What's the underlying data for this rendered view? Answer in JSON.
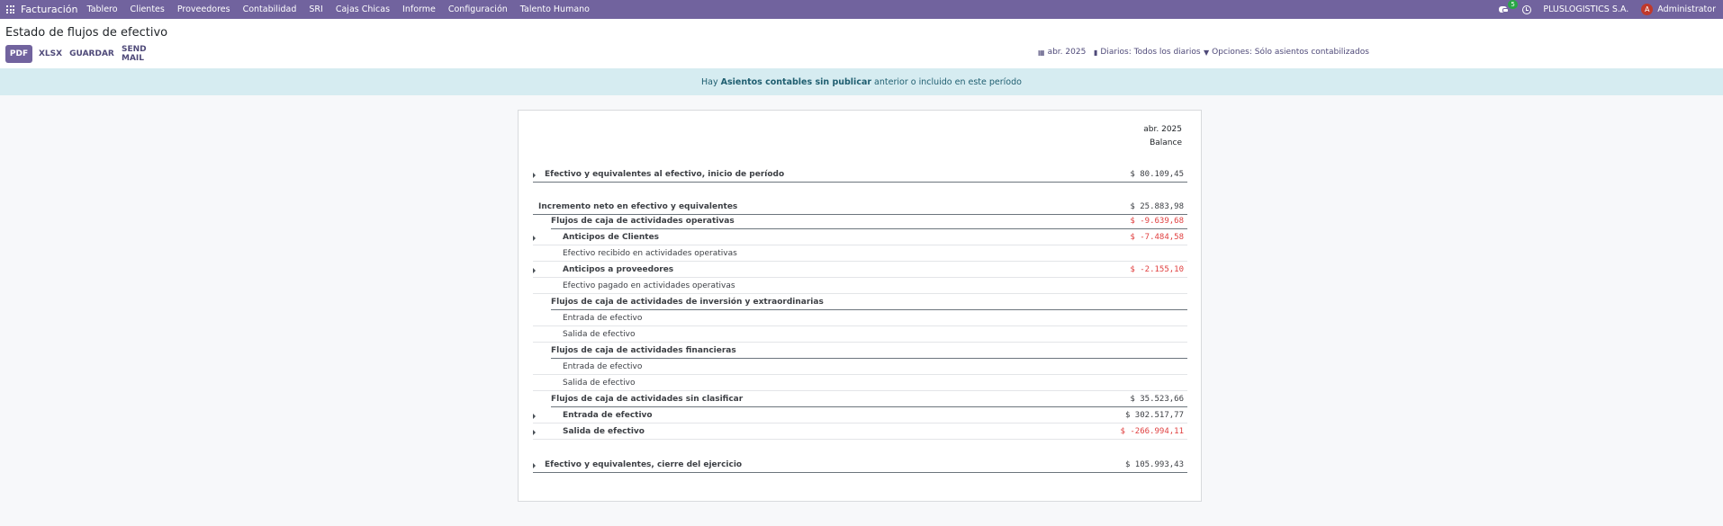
{
  "navbar": {
    "brand": "Facturación",
    "menu": [
      "Tablero",
      "Clientes",
      "Proveedores",
      "Contabilidad",
      "SRI",
      "Cajas Chicas",
      "Informe",
      "Configuración",
      "Talento Humano"
    ],
    "chat_count": "5",
    "company": "PLUSLOGISTICS S.A.",
    "avatar_letter": "A",
    "user": "Administrator"
  },
  "control_panel": {
    "title": "Estado de flujos de efectivo",
    "buttons": {
      "pdf": "PDF",
      "xlsx": "XLSX",
      "save": "GUARDAR",
      "send_mail": "SEND MAIL"
    },
    "filters": {
      "date": "abr. 2025",
      "journals": "Diarios: Todos los diarios",
      "options": "Opciones: Sólo asientos contabilizados"
    }
  },
  "alert": {
    "prefix": "Hay",
    "link": "Asientos contables sin publicar",
    "suffix": "anterior o incluido en este período"
  },
  "report": {
    "column_period": "abr. 2025",
    "column_name": "Balance",
    "rows": [
      {
        "label": "Efectivo y equivalentes al efectivo, inicio de período",
        "value": "$ 80.109,45"
      },
      {
        "label": "Incremento neto en efectivo y equivalentes",
        "value": "$ 25.883,98"
      },
      {
        "label": "Flujos de caja de actividades operativas",
        "value": "$ -9.639,68"
      },
      {
        "label": "Anticipos de Clientes",
        "value": "$ -7.484,58"
      },
      {
        "label": "Efectivo recibido en actividades operativas",
        "value": ""
      },
      {
        "label": "Anticipos a proveedores",
        "value": "$ -2.155,10"
      },
      {
        "label": "Efectivo pagado en actividades operativas",
        "value": ""
      },
      {
        "label": "Flujos de caja de actividades de inversión y extraordinarias",
        "value": ""
      },
      {
        "label": "Entrada de efectivo",
        "value": ""
      },
      {
        "label": "Salida de efectivo",
        "value": ""
      },
      {
        "label": "Flujos de caja de actividades financieras",
        "value": ""
      },
      {
        "label": "Entrada de efectivo",
        "value": ""
      },
      {
        "label": "Salida de efectivo",
        "value": ""
      },
      {
        "label": "Flujos de caja de actividades sin clasificar",
        "value": "$ 35.523,66"
      },
      {
        "label": "Entrada de efectivo",
        "value": "$ 302.517,77"
      },
      {
        "label": "Salida de efectivo",
        "value": "$ -266.994,11"
      },
      {
        "label": "Efectivo y equivalentes, cierre del ejercicio",
        "value": "$ 105.993,43"
      }
    ]
  },
  "colors": {
    "navbar": "#71639e",
    "negative": "#e04040",
    "alert_bg": "#d6ecf1"
  }
}
